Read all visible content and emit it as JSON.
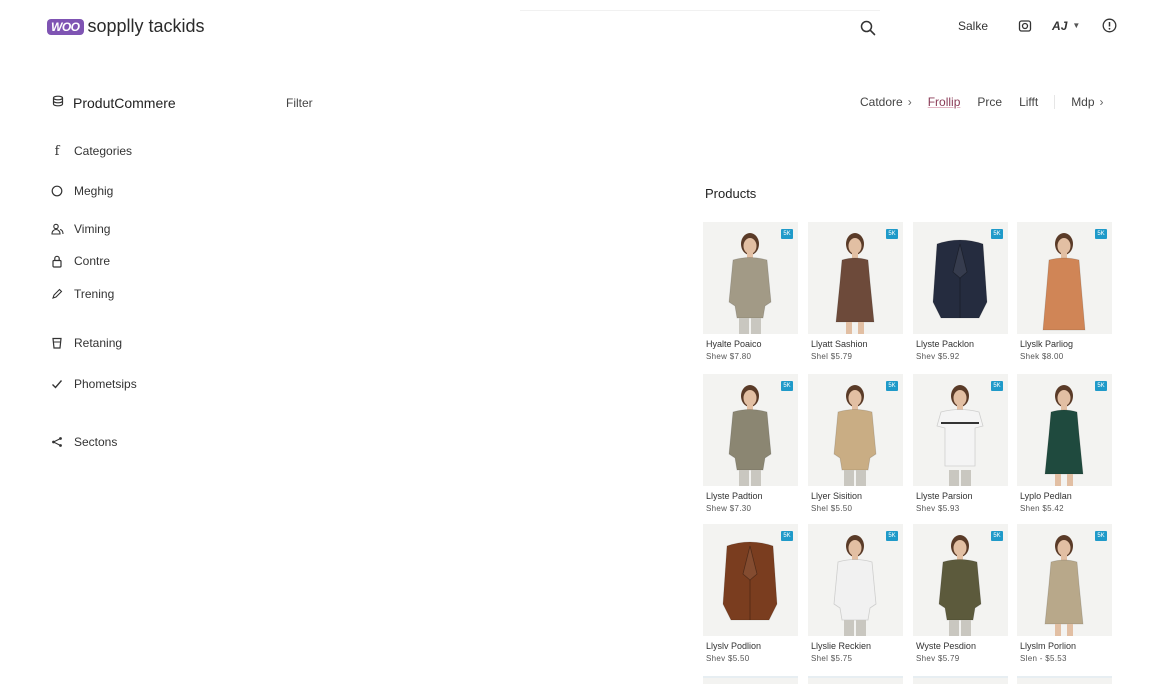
{
  "header": {
    "brand_logo": "WOO",
    "brand_name": "sopplly tackids",
    "search_placeholder": "",
    "sale_label": "Salke",
    "user_label": "AJ"
  },
  "subnav": {
    "section_title": "ProdutCommere",
    "filter_label": "Filter",
    "items": [
      {
        "label": "Catdore"
      },
      {
        "label": "Frollip"
      },
      {
        "label": "Prce"
      },
      {
        "label": "Lifft"
      },
      {
        "label": "Mdp"
      }
    ]
  },
  "sidebar": {
    "items": [
      {
        "label": "Categories",
        "icon": "f-icon"
      },
      {
        "label": "Meghig",
        "icon": "circle-icon"
      },
      {
        "label": "Viming",
        "icon": "people-icon"
      },
      {
        "label": "Contre",
        "icon": "lock-icon"
      },
      {
        "label": "Trening",
        "icon": "pencil-icon"
      },
      {
        "label": "Retaning",
        "icon": "cup-icon"
      },
      {
        "label": "Phometsips",
        "icon": "check-icon"
      },
      {
        "label": "Sectons",
        "icon": "share-icon"
      }
    ]
  },
  "products": {
    "title": "Products",
    "items": [
      {
        "name": "Hyalte Poaico",
        "price": "Shew  $7.80",
        "badge": "5K",
        "color": "#a29a86",
        "kind": "sweater"
      },
      {
        "name": "Llyatt Sashion",
        "price": "Shel  $5.79",
        "badge": "5K",
        "color": "#6d4a3a",
        "kind": "dress"
      },
      {
        "name": "Llyste Packlon",
        "price": "Shev  $5.92",
        "badge": "5K",
        "color": "#252c3f",
        "kind": "jacket"
      },
      {
        "name": "Llyslk Parliog",
        "price": "Shek  $8.00",
        "badge": "5K",
        "color": "#d08556",
        "kind": "dress-long"
      },
      {
        "name": "Llyste Padtion",
        "price": "Shew  $7.30",
        "badge": "5K",
        "color": "#8b8672",
        "kind": "sweater"
      },
      {
        "name": "Llyer Sisition",
        "price": "Shel  $5.50",
        "badge": "5K",
        "color": "#c9ad84",
        "kind": "sweater"
      },
      {
        "name": "Llyste Parsion",
        "price": "Shev  $5.93",
        "badge": "5K",
        "color": "#f4f4f4",
        "kind": "tee"
      },
      {
        "name": "Lyplo Pedlan",
        "price": "Shen  $5.42",
        "badge": "5K",
        "color": "#1f4a3e",
        "kind": "dress"
      },
      {
        "name": "Llyslv Podlion",
        "price": "Shev  $5.50",
        "badge": "5K",
        "color": "#7a3d1f",
        "kind": "jacket"
      },
      {
        "name": "Llyslie Reckien",
        "price": "Shel  $5.75",
        "badge": "5K",
        "color": "#f1f1f1",
        "kind": "sweater"
      },
      {
        "name": "Wyste Pesdion",
        "price": "Shev  $5.79",
        "badge": "5K",
        "color": "#5c5a3c",
        "kind": "sweater"
      },
      {
        "name": "Llyslm Porlion",
        "price": "Slen - $5.53",
        "badge": "5K",
        "color": "#b8a88a",
        "kind": "dress"
      }
    ]
  }
}
